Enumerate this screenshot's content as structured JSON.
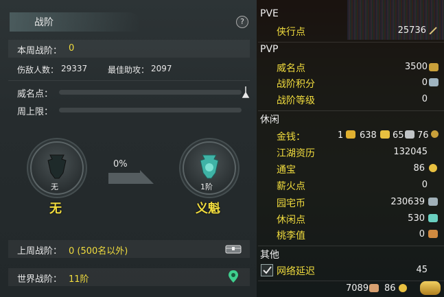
{
  "left": {
    "title": "战阶",
    "help_label": "?",
    "weekly_rank_label": "本周战阶：",
    "weekly_rank_value": "0",
    "kills_label": "伤敌人数：",
    "kills_value": "29337",
    "assists_label": "最佳助攻：",
    "assists_value": "2097",
    "prestige_label": "威名点：",
    "prestige_progress": 0,
    "weekly_cap_label": "周上限：",
    "weekly_cap_progress": 0,
    "current_medal_level": "无",
    "current_medal_name": "无",
    "progress_percent": "0%",
    "next_medal_level": "1阶",
    "next_medal_name": "义魁",
    "last_week_label": "上周战阶：",
    "last_week_value": "0 (500名以外)",
    "world_rank_label": "世界战阶：",
    "world_rank_value": "11阶"
  },
  "right": {
    "pve": {
      "title": "PVE",
      "items": [
        {
          "label": "侠行点",
          "value": "25736"
        }
      ]
    },
    "pvp": {
      "title": "PVP",
      "items": [
        {
          "label": "威名点",
          "value": "3500"
        },
        {
          "label": "战阶积分",
          "value": "0"
        },
        {
          "label": "战阶等级",
          "value": "0"
        }
      ]
    },
    "leisure": {
      "title": "休闲",
      "money_label": "金钱：",
      "money_gold": "1",
      "money_silver": "638",
      "money_copper_a": "65",
      "money_copper_b": "76",
      "items": [
        {
          "label": "江湖资历",
          "value": "132045"
        },
        {
          "label": "通宝",
          "value": "86"
        },
        {
          "label": "薪火点",
          "value": "0"
        },
        {
          "label": "园宅币",
          "value": "230639"
        },
        {
          "label": "休闲点",
          "value": "530"
        },
        {
          "label": "桃李值",
          "value": "0"
        }
      ]
    },
    "other": {
      "title": "其他",
      "latency_label": "网络延迟",
      "latency_checked": true,
      "latency_value": "45"
    },
    "footer": {
      "value_a": "7089",
      "value_b": "86"
    }
  },
  "colors": {
    "accent_yellow": "#f2dd3e",
    "panel_text": "#e8e8e8"
  }
}
